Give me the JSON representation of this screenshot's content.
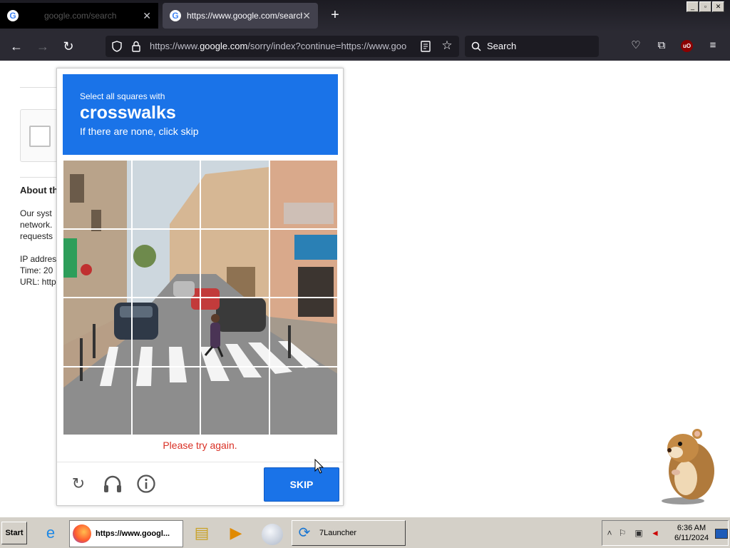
{
  "browser": {
    "tabs": [
      {
        "label": "google.com/search",
        "active": false
      },
      {
        "label": "https://www.google.com/search?q",
        "active": true
      }
    ],
    "new_tab": "+",
    "url_prefix": "https://www.",
    "url_domain": "google.com",
    "url_rest": "/sorry/index?continue=https://www.goo",
    "search_placeholder": "Search"
  },
  "background_page": {
    "heading": "About th",
    "lines": [
      "Our syst",
      "network.",
      "requests"
    ],
    "ip_label": "IP addres",
    "time_label": "Time: 20",
    "url_label": "URL: http"
  },
  "captcha": {
    "instruction": "Select all squares with",
    "target": "crosswalks",
    "hint": "If there are none, click skip",
    "error": "Please try again.",
    "skip_label": "SKIP",
    "grid_size": 4
  },
  "taskbar": {
    "start_label": "Start",
    "firefox_task": "https://www.googl...",
    "launcher_task": "7Launcher",
    "time": "6:36 AM",
    "date": "6/11/2024"
  },
  "colors": {
    "accent": "#1a73e8",
    "error": "#d93025",
    "browser_chrome": "#2b2a33"
  }
}
